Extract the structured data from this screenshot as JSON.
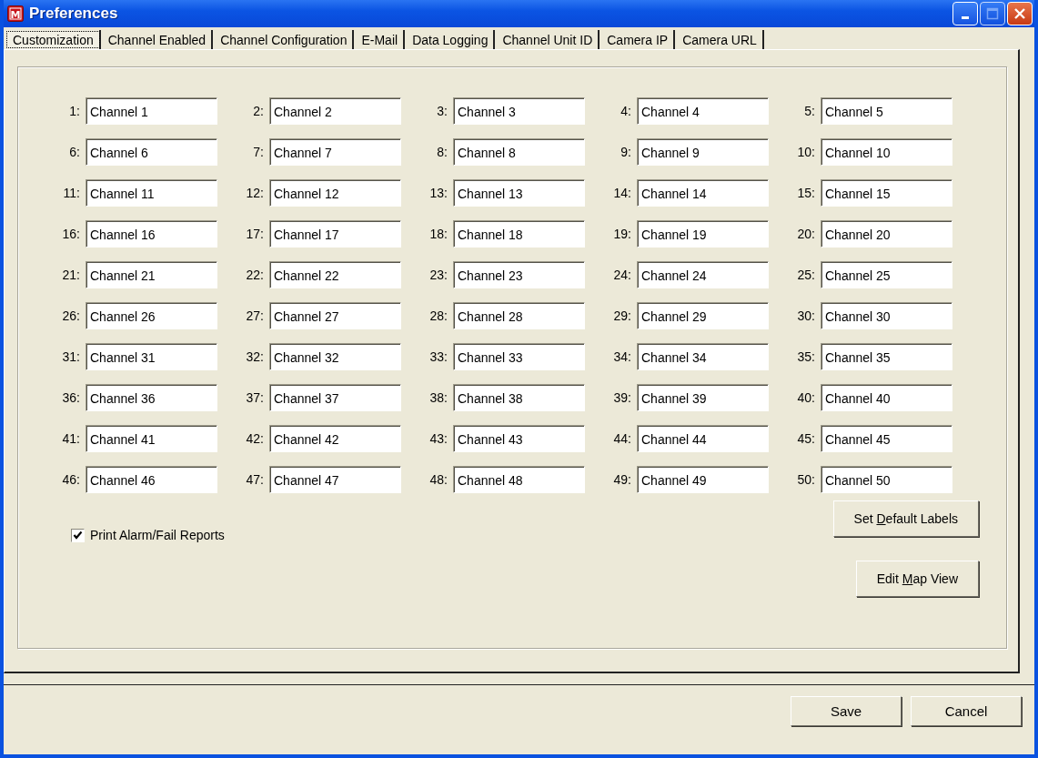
{
  "window": {
    "title": "Preferences",
    "app_icon": "M"
  },
  "tabs": [
    {
      "label": "Customization",
      "selected": true
    },
    {
      "label": "Channel Enabled",
      "selected": false
    },
    {
      "label": "Channel Configuration",
      "selected": false
    },
    {
      "label": "E-Mail",
      "selected": false
    },
    {
      "label": "Data Logging",
      "selected": false
    },
    {
      "label": "Channel Unit ID",
      "selected": false
    },
    {
      "label": "Camera IP",
      "selected": false
    },
    {
      "label": "Camera URL",
      "selected": false
    }
  ],
  "channels": [
    {
      "number": "1:",
      "value": "Channel 1"
    },
    {
      "number": "2:",
      "value": "Channel 2"
    },
    {
      "number": "3:",
      "value": "Channel 3"
    },
    {
      "number": "4:",
      "value": "Channel 4"
    },
    {
      "number": "5:",
      "value": "Channel 5"
    },
    {
      "number": "6:",
      "value": "Channel 6"
    },
    {
      "number": "7:",
      "value": "Channel 7"
    },
    {
      "number": "8:",
      "value": "Channel 8"
    },
    {
      "number": "9:",
      "value": "Channel 9"
    },
    {
      "number": "10:",
      "value": "Channel 10"
    },
    {
      "number": "11:",
      "value": "Channel 11"
    },
    {
      "number": "12:",
      "value": "Channel 12"
    },
    {
      "number": "13:",
      "value": "Channel 13"
    },
    {
      "number": "14:",
      "value": "Channel 14"
    },
    {
      "number": "15:",
      "value": "Channel 15"
    },
    {
      "number": "16:",
      "value": "Channel 16"
    },
    {
      "number": "17:",
      "value": "Channel 17"
    },
    {
      "number": "18:",
      "value": "Channel 18"
    },
    {
      "number": "19:",
      "value": "Channel 19"
    },
    {
      "number": "20:",
      "value": "Channel 20"
    },
    {
      "number": "21:",
      "value": "Channel 21"
    },
    {
      "number": "22:",
      "value": "Channel 22"
    },
    {
      "number": "23:",
      "value": "Channel 23"
    },
    {
      "number": "24:",
      "value": "Channel 24"
    },
    {
      "number": "25:",
      "value": "Channel 25"
    },
    {
      "number": "26:",
      "value": "Channel 26"
    },
    {
      "number": "27:",
      "value": "Channel 27"
    },
    {
      "number": "28:",
      "value": "Channel 28"
    },
    {
      "number": "29:",
      "value": "Channel 29"
    },
    {
      "number": "30:",
      "value": "Channel 30"
    },
    {
      "number": "31:",
      "value": "Channel 31"
    },
    {
      "number": "32:",
      "value": "Channel 32"
    },
    {
      "number": "33:",
      "value": "Channel 33"
    },
    {
      "number": "34:",
      "value": "Channel 34"
    },
    {
      "number": "35:",
      "value": "Channel 35"
    },
    {
      "number": "36:",
      "value": "Channel 36"
    },
    {
      "number": "37:",
      "value": "Channel 37"
    },
    {
      "number": "38:",
      "value": "Channel 38"
    },
    {
      "number": "39:",
      "value": "Channel 39"
    },
    {
      "number": "40:",
      "value": "Channel 40"
    },
    {
      "number": "41:",
      "value": "Channel 41"
    },
    {
      "number": "42:",
      "value": "Channel 42"
    },
    {
      "number": "43:",
      "value": "Channel 43"
    },
    {
      "number": "44:",
      "value": "Channel 44"
    },
    {
      "number": "45:",
      "value": "Channel 45"
    },
    {
      "number": "46:",
      "value": "Channel 46"
    },
    {
      "number": "47:",
      "value": "Channel 47"
    },
    {
      "number": "48:",
      "value": "Channel 48"
    },
    {
      "number": "49:",
      "value": "Channel 49"
    },
    {
      "number": "50:",
      "value": "Channel 50"
    }
  ],
  "print_reports": {
    "label": "Print Alarm/Fail Reports",
    "checked": true
  },
  "panel_buttons": [
    {
      "before": "Set ",
      "access_key": "D",
      "after": "efault Labels"
    },
    {
      "before": "Edit ",
      "access_key": "M",
      "after": "ap View"
    }
  ],
  "dialog_buttons": [
    "Save",
    "Cancel"
  ]
}
